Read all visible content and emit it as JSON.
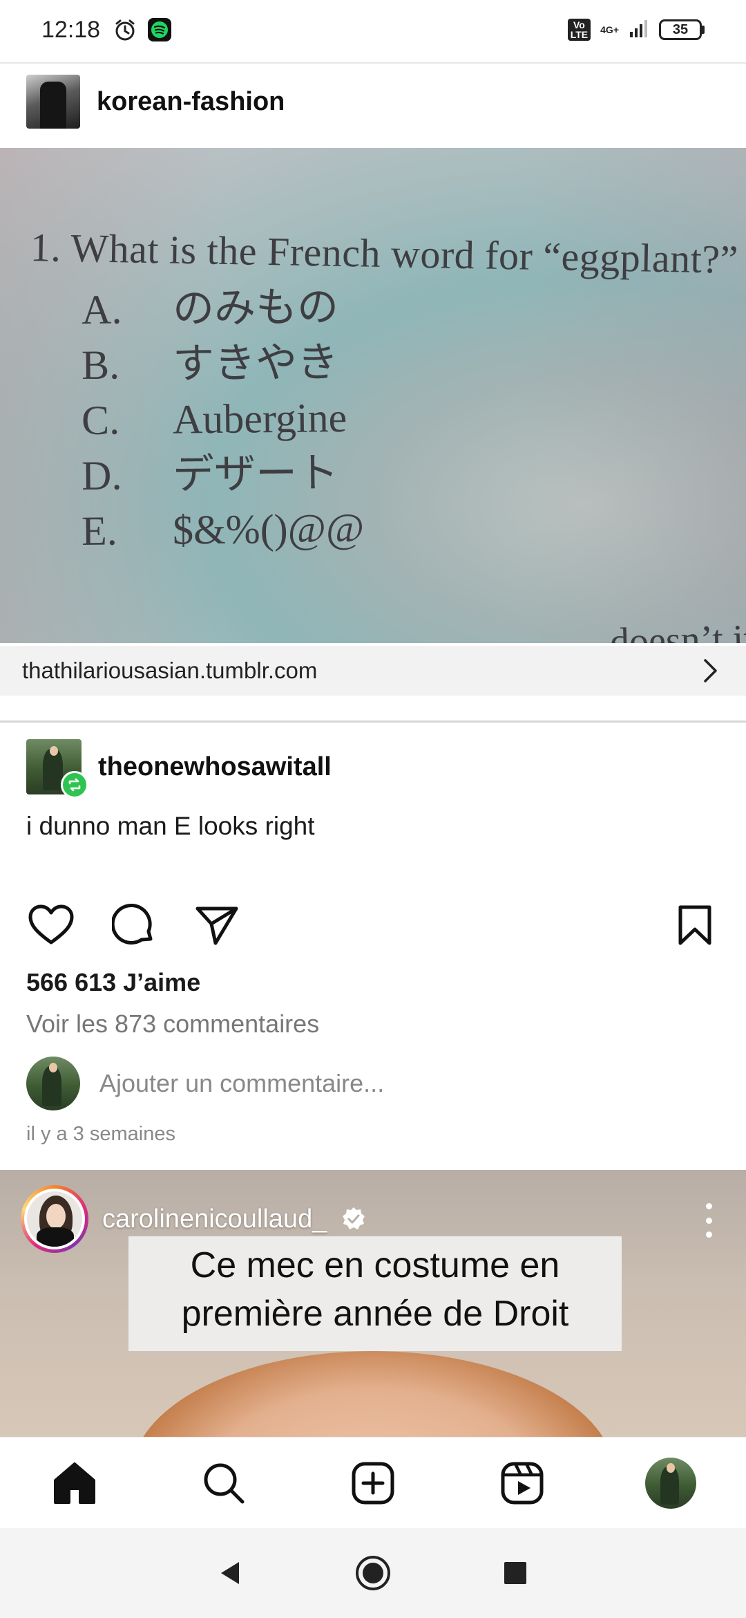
{
  "status_bar": {
    "time": "12:18",
    "left_icons": [
      "alarm-icon",
      "spotify-icon"
    ],
    "volte": "Vo\nLTE",
    "network": "4G+",
    "battery": "35"
  },
  "post": {
    "username": "korean-fashion",
    "image": {
      "question": "1.  What is the French word for “eggplant?”",
      "options": [
        {
          "letter": "A.",
          "text": "のみもの"
        },
        {
          "letter": "B.",
          "text": "すきやき"
        },
        {
          "letter": "C.",
          "text": "Aubergine"
        },
        {
          "letter": "D.",
          "text": "デザート"
        },
        {
          "letter": "E.",
          "text": "$&%()@@"
        }
      ],
      "partial_text": "doesn’t it"
    },
    "link": {
      "url": "thathilariousasian.tumblr.com",
      "chevron_icon": "chevron-right-icon"
    },
    "reblog": {
      "username": "theonewhosawitall",
      "badge_icon": "reblog-icon",
      "text": "i dunno man E looks right"
    },
    "actions": {
      "like_icon": "heart-icon",
      "comment_icon": "comment-icon",
      "share_icon": "send-icon",
      "save_icon": "bookmark-icon"
    },
    "likes": "566 613 J’aime",
    "view_comments": "Voir les 873 commentaires",
    "add_comment_placeholder": "Ajouter un commentaire...",
    "timestamp": "il y a 3 semaines"
  },
  "next_post": {
    "username": "carolinenicoullaud_",
    "verified_icon": "verified-badge-icon",
    "more_icon": "more-vertical-icon",
    "caption_lines": [
      "Ce mec en costume en",
      "première année de Droit"
    ]
  },
  "bottom_nav": {
    "items": [
      "home-icon",
      "search-icon",
      "create-icon",
      "reels-icon",
      "profile-avatar"
    ]
  },
  "system_nav": {
    "items": [
      "back-icon",
      "home-circle-icon",
      "recents-icon"
    ]
  },
  "colors": {
    "reblog_green": "#2fc451",
    "secondary_text": "#777777",
    "link_bar_bg": "#f2f2f2"
  }
}
